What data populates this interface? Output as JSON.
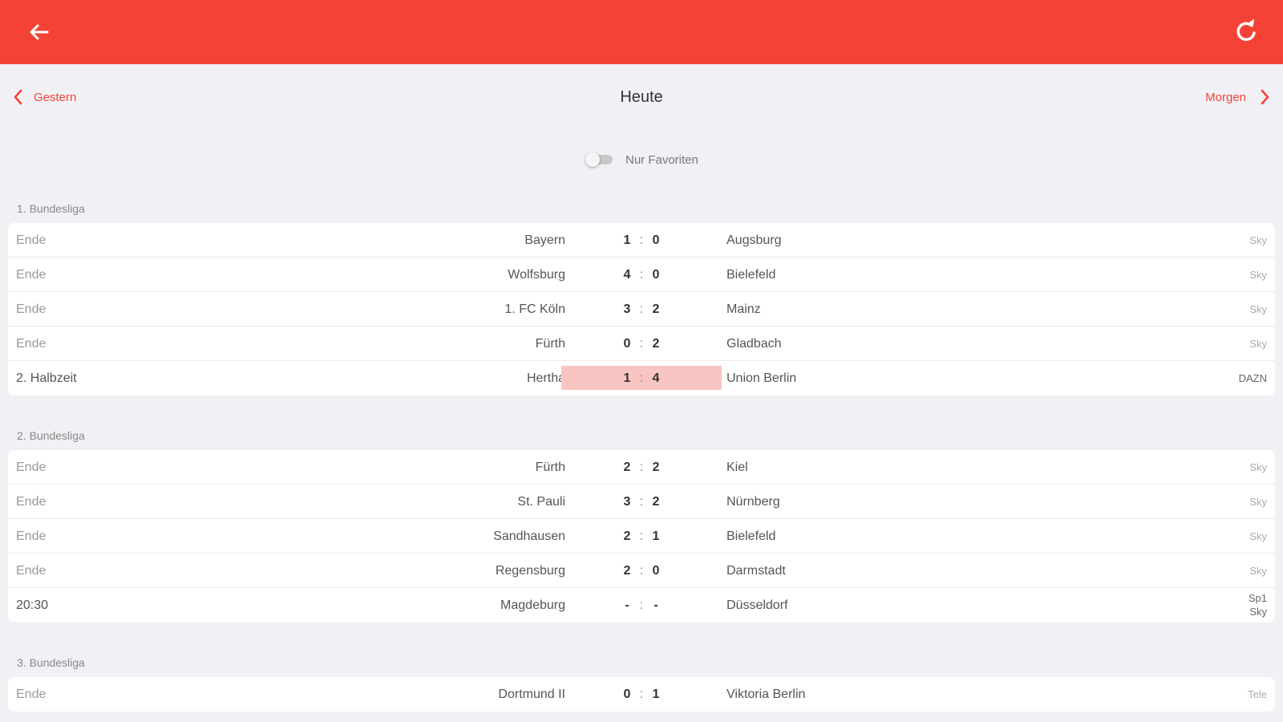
{
  "header": {
    "accent": "#f44336"
  },
  "date_nav": {
    "prev_label": "Gestern",
    "title": "Heute",
    "next_label": "Morgen"
  },
  "favorites_toggle": {
    "label": "Nur Favoriten",
    "on": false
  },
  "leagues": [
    {
      "name": "1. Bundesliga",
      "matches": [
        {
          "status": "Ende",
          "home": "Bayern",
          "home_score": "1",
          "away_score": "0",
          "away": "Augsburg",
          "tv": "Sky"
        },
        {
          "status": "Ende",
          "home": "Wolfsburg",
          "home_score": "4",
          "away_score": "0",
          "away": "Bielefeld",
          "tv": "Sky"
        },
        {
          "status": "Ende",
          "home": "1. FC Köln",
          "home_score": "3",
          "away_score": "2",
          "away": "Mainz",
          "tv": "Sky"
        },
        {
          "status": "Ende",
          "home": "Fürth",
          "home_score": "0",
          "away_score": "2",
          "away": "Gladbach",
          "tv": "Sky"
        },
        {
          "status": "2. Halbzeit",
          "home": "Hertha",
          "home_score": "1",
          "away_score": "4",
          "away": "Union Berlin",
          "tv": "DAZN",
          "live": true
        }
      ]
    },
    {
      "name": "2. Bundesliga",
      "matches": [
        {
          "status": "Ende",
          "home": "Fürth",
          "home_score": "2",
          "away_score": "2",
          "away": "Kiel",
          "tv": "Sky"
        },
        {
          "status": "Ende",
          "home": "St. Pauli",
          "home_score": "3",
          "away_score": "2",
          "away": "Nürnberg",
          "tv": "Sky"
        },
        {
          "status": "Ende",
          "home": "Sandhausen",
          "home_score": "2",
          "away_score": "1",
          "away": "Bielefeld",
          "tv": "Sky"
        },
        {
          "status": "Ende",
          "home": "Regensburg",
          "home_score": "2",
          "away_score": "0",
          "away": "Darmstadt",
          "tv": "Sky"
        },
        {
          "status": "20:30",
          "home": "Magdeburg",
          "home_score": "-",
          "away_score": "-",
          "away": "Düsseldorf",
          "tv": "Sp1",
          "tv2": "Sky",
          "upcoming": true
        }
      ]
    },
    {
      "name": "3. Bundesliga",
      "matches": [
        {
          "status": "Ende",
          "home": "Dortmund II",
          "home_score": "0",
          "away_score": "1",
          "away": "Viktoria Berlin",
          "tv": "Tele"
        }
      ]
    }
  ]
}
